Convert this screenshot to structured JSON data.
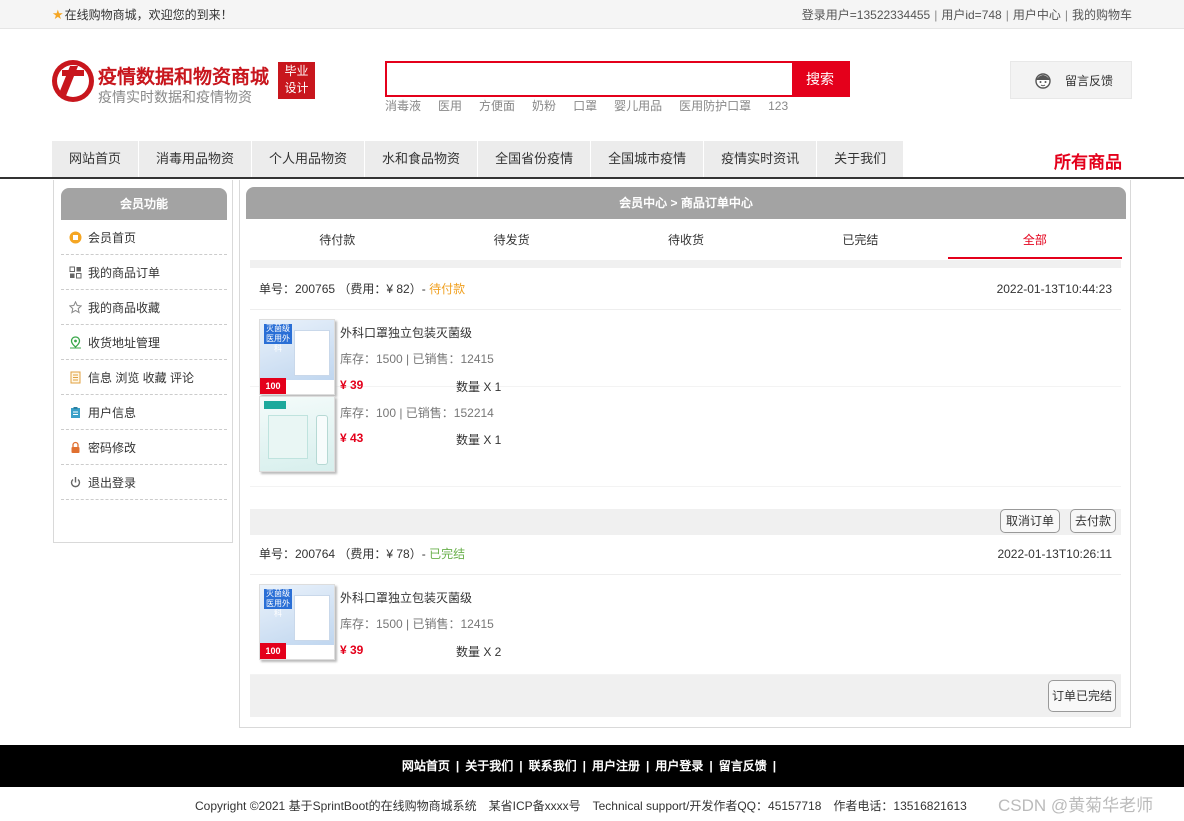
{
  "topbar": {
    "welcome": "在线购物商城，欢迎您的到来！",
    "login_user": "登录用户=13522334455",
    "user_id": "用户id=748",
    "user_center": "用户中心",
    "my_cart": "我的购物车"
  },
  "header": {
    "site_title": "疫情数据和物资商城",
    "site_subtitle": "疫情实时数据和疫情物资",
    "badge_line1": "毕业",
    "badge_line2": "设计",
    "search_placeholder": "",
    "search_button": "搜索",
    "hot_words": [
      "消毒液",
      "医用",
      "方便面",
      "奶粉",
      "口罩",
      "婴儿用品",
      "医用防护口罩",
      "123"
    ],
    "feedback": "留言反馈"
  },
  "nav": {
    "items": [
      "网站首页",
      "消毒用品物资",
      "个人用品物资",
      "水和食品物资",
      "全国省份疫情",
      "全国城市疫情",
      "疫情实时资讯",
      "关于我们"
    ],
    "all_goods": "所有商品"
  },
  "sidebar": {
    "title": "会员功能",
    "items": [
      "会员首页",
      "我的商品订单",
      "我的商品收藏",
      "收货地址管理",
      "信息 浏览 收藏 评论",
      "用户信息",
      "密码修改",
      "退出登录"
    ]
  },
  "main": {
    "breadcrumb": "会员中心 > 商品订单中心",
    "tabs": [
      "待付款",
      "待发货",
      "待收货",
      "已完结",
      "全部"
    ],
    "active_tab": "全部",
    "orders": [
      {
        "order_prefix": "单号：200765 （费用：¥ 82）- ",
        "status": "待付款",
        "time": "2022-01-13T10:44:23",
        "items": [
          {
            "name": "外科口罩独立包装灭菌级",
            "stock": "库存：1500 | 已销售：12415",
            "price": "¥ 39",
            "qty": "数量 X 1",
            "thumb_text": "灭菌级 医用外科",
            "thumb_badge": "100"
          },
          {
            "name": "",
            "stock": "库存：100 | 已销售：152214",
            "price": "¥ 43",
            "qty": "数量 X 1"
          }
        ],
        "actions": [
          "取消订单",
          "去付款"
        ]
      },
      {
        "order_prefix": "单号：200764 （费用：¥ 78）- ",
        "status": "已完结",
        "time": "2022-01-13T10:26:11",
        "items": [
          {
            "name": "外科口罩独立包装灭菌级",
            "stock": "库存：1500 | 已销售：12415",
            "price": "¥ 39",
            "qty": "数量 X 2",
            "thumb_text": "灭菌级 医用外科",
            "thumb_badge": "100"
          }
        ],
        "actions": [
          "订单已完结"
        ]
      }
    ]
  },
  "footer": {
    "links": [
      "网站首页",
      "关于我们",
      "联系我们",
      "用户注册",
      "用户登录",
      "留言反馈"
    ],
    "copyright": "Copyright ©2021 基于SprintBoot的在线购物商城系统",
    "icp": "某省ICP备xxxx号",
    "support": "Technical support/开发作者QQ：45157718",
    "phone": "作者电话：13516821613",
    "watermark": "CSDN @黄菊华老师"
  },
  "colors": {
    "accent": "#e4001b",
    "brand": "#c8161d",
    "pending": "#f0a020",
    "done": "#6ab04c"
  }
}
